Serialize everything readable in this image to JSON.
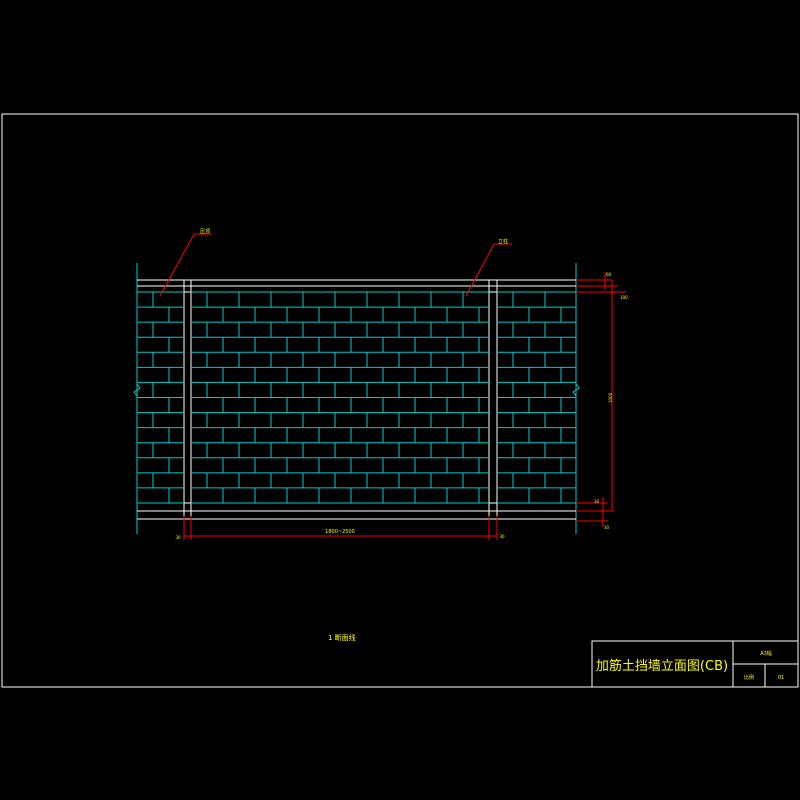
{
  "drawing": {
    "title_block": {
      "title": "加筋土挡墙立面图(CB)",
      "top_right": "A3幅",
      "bottom_left": "比例",
      "bottom_right": "01"
    },
    "caption": "1 断面线",
    "leaders": [
      {
        "label": "压顶"
      },
      {
        "label": "立柱"
      }
    ],
    "dimensions": {
      "span": "1800~2500",
      "post_left": "30",
      "post_right": "30",
      "right_top_1": "60",
      "right_top_2": "100",
      "right_height": "1000",
      "right_bottom_1": "30",
      "right_bottom_2": "30"
    },
    "colors": {
      "background": "#000000",
      "frame": "#ffffff",
      "brick": "#00cccc",
      "dimension": "#ff0000",
      "text": "#ffff00"
    }
  }
}
